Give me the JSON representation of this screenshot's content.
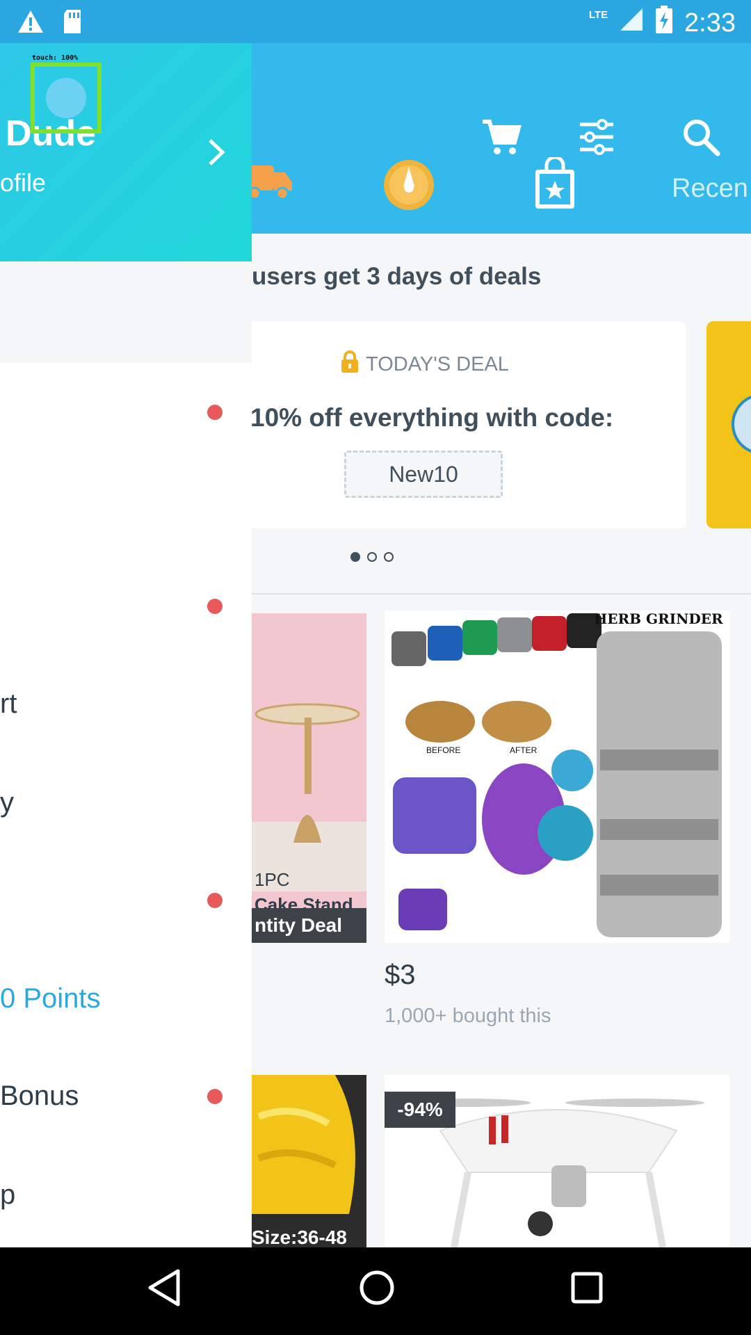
{
  "status_bar": {
    "time": "2:33",
    "network": "LTE",
    "icons": [
      "warning-icon",
      "sd-card-icon",
      "signal-icon",
      "battery-charging-icon"
    ]
  },
  "header": {
    "icons": [
      "cart-icon",
      "filter-icon",
      "search-icon"
    ],
    "categories": [
      "truck-icon",
      "flash-sale-icon",
      "shopping-bag-icon"
    ],
    "recent_label": "Recen"
  },
  "promo": {
    "headline": "users get 3 days of deals"
  },
  "deal": {
    "badge": "TODAY'S DEAL",
    "title": "10% off everything with code:",
    "code": "New10"
  },
  "products": [
    {
      "caption": "1PC",
      "caption2": "Cake Stand",
      "tag": "ntity Deal"
    },
    {
      "price": "$3",
      "bought": "1,000+ bought this",
      "image_text": "HERB GRINDER",
      "before": "BEFORE",
      "after": "AFTER"
    },
    {
      "caption": "Size:36-48"
    },
    {
      "discount": "-94%"
    }
  ],
  "drawer": {
    "name": "Dude",
    "subtitle": "ofile",
    "menu": [
      {
        "label": "",
        "has_dot": true
      },
      {
        "label": "",
        "has_dot": true
      },
      {
        "label": "rt",
        "has_dot": false
      },
      {
        "label": "y",
        "has_dot": false
      },
      {
        "label": "",
        "has_dot": true
      },
      {
        "label": "0 Points",
        "has_dot": false,
        "accent": true
      },
      {
        "label": "Bonus",
        "has_dot": true
      },
      {
        "label": "p",
        "has_dot": false
      }
    ]
  },
  "touch_overlay": {
    "label": "touch: 100%"
  },
  "colors": {
    "header": "#34b9ec",
    "status_bar": "#2aa6e0",
    "drawer_header": "#2ec8e8",
    "accent": "#29a9df",
    "notification_dot": "#e85a5a"
  }
}
